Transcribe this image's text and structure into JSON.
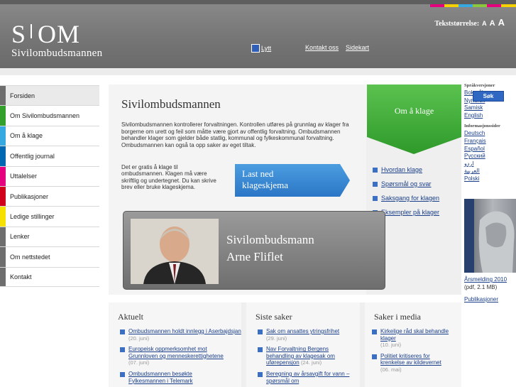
{
  "header": {
    "logo_mark_left": "S",
    "logo_mark_right": "OM",
    "logo_name": "Sivilombudsmannen",
    "text_size_label": "Tekststørrelse:",
    "text_size_a1": "A",
    "text_size_a2": "A",
    "text_size_a3": "A",
    "listen_label": "Lytt",
    "links": [
      "Kontakt oss",
      "Sidekart"
    ],
    "color_strip": [
      "#e5007e",
      "#f6d100",
      "#36a9e1",
      "#8cc63e",
      "#e5007e",
      "#f6d100"
    ]
  },
  "nav": {
    "items": [
      {
        "label": "Forsiden",
        "color": "#6e6e6e",
        "active": true
      },
      {
        "label": "Om Sivilombudsmannen",
        "color": "#33a02c"
      },
      {
        "label": "Om å klage",
        "color": "#36a9e1"
      },
      {
        "label": "Offentlig journal",
        "color": "#0067b1"
      },
      {
        "label": "Uttalelser",
        "color": "#e5007e"
      },
      {
        "label": "Publikasjoner",
        "color": "#d0021b"
      },
      {
        "label": "Ledige stillinger",
        "color": "#f6e000"
      },
      {
        "label": "Lenker",
        "color": "#6e6e6e"
      },
      {
        "label": "Om nettstedet",
        "color": "#6e6e6e"
      },
      {
        "label": "Kontakt",
        "color": "#6e6e6e"
      }
    ]
  },
  "main": {
    "title": "Sivilombudsmannen",
    "intro": "Sivilombudsmannen kontrollerer forvaltningen. Kontrollen utføres på grunnlag av klager fra borgerne om urett og feil som måtte være gjort av offentlig forvaltning. Ombudsmannen behandler klager som gjelder både statlig, kommunal og fylkeskommunal forvaltning. Ombudsmannen kan også ta opp saker av eget tiltak.",
    "free_text": "Det er gratis å klage til ombudsmannen. Klagen må være skriftlig og undertegnet. Du kan skrive brev eller bruke klageskjema.",
    "download_label": "Last ned klageskjema",
    "person_name_line1": "Sivilombudsmann",
    "person_name_line2": "Arne Fliflet"
  },
  "klage": {
    "title": "Om å klage",
    "links": [
      "Hvordan klage",
      "Spørsmål og svar",
      "Saksgang for klagen",
      "Eksempler på klager"
    ],
    "accent": "#3aaa35"
  },
  "right": {
    "lang_heading": "Språkversjoner",
    "lang_links": [
      "Bokmål",
      "Nynorsk",
      "Samisk",
      "English"
    ],
    "search_label": "Søk",
    "info_heading": "Informasjonssider",
    "info_links": [
      "Deutsch",
      "Français",
      "Español",
      "Русский",
      "اردو",
      "العربية",
      "",
      "Polski"
    ],
    "report_caption": "Årsmelding 2010",
    "report_meta": "(pdf, 2.1 MB)",
    "publications_link": "Publikasjoner"
  },
  "bottom": {
    "aktuelt": {
      "title": "Aktuelt",
      "items": [
        {
          "text": "Ombudsmannen holdt innlegg i Aserbajdsjan",
          "date": "(20. juni)"
        },
        {
          "text": "Europeisk oppmerksomhet mot Grunnloven og menneskerettighetene",
          "date": "(07. juni)"
        },
        {
          "text": "Ombudsmannen besøkte Fylkesmannen i Telemark",
          "date": ""
        }
      ]
    },
    "siste": {
      "title": "Siste saker",
      "items": [
        {
          "text": "Sak om ansattes ytringsfrihet",
          "date": "(29. juni)"
        },
        {
          "text": "Nav Forvaltning Bergens behandling av klagesak om uførepensjon",
          "date": "(24. juni)"
        },
        {
          "text": "Beregning av årsavgift for vann – spørsmål om",
          "date": ""
        }
      ]
    },
    "media": {
      "title": "Saker i media",
      "items": [
        {
          "text": "Kirkelige råd skal behandle klager",
          "date": "(10. juni)"
        },
        {
          "text": "Politiet kritiseres for krenkelse av kildevernet",
          "date": "(06. mai)"
        }
      ]
    }
  }
}
